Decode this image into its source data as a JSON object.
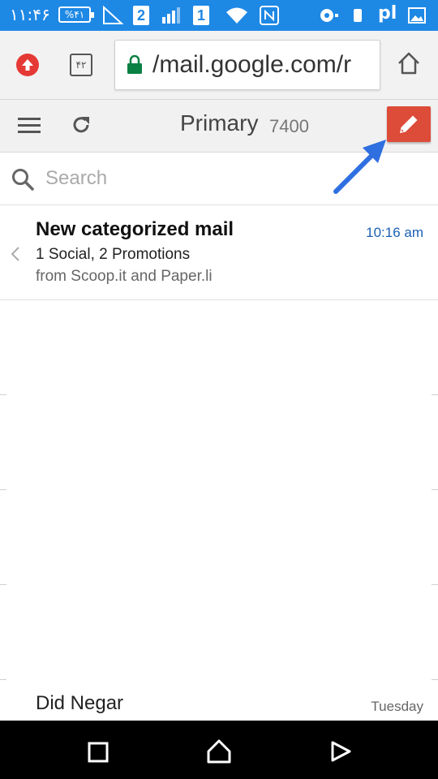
{
  "status_bar": {
    "time": "۱۱:۴۶",
    "battery": "%۴۱",
    "notif_2": "2",
    "notif_1": "1",
    "signal_text": "pl"
  },
  "browser": {
    "tab_count": "۴۲",
    "url": "/mail.google.com/r",
    "icons": [
      "update-icon",
      "tabs-icon",
      "lock-icon",
      "home-icon"
    ]
  },
  "toolbar": {
    "title": "Primary",
    "count": "7400",
    "icons": [
      "menu-icon",
      "refresh-icon",
      "pencil-icon"
    ],
    "compose_color": "#dd4b39"
  },
  "search": {
    "placeholder": "Search"
  },
  "messages": [
    {
      "title": "New categorized mail",
      "time": "10:16 am",
      "subtitle": "1 Social, 2 Promotions",
      "from": "from Scoop.it and Paper.li"
    },
    {
      "title": "Did Negar",
      "time": "Tuesday"
    }
  ],
  "colors": {
    "status_bar": "#1e88e5",
    "annotation_arrow": "#2f6fe0",
    "time_link": "#1a5fb4"
  }
}
